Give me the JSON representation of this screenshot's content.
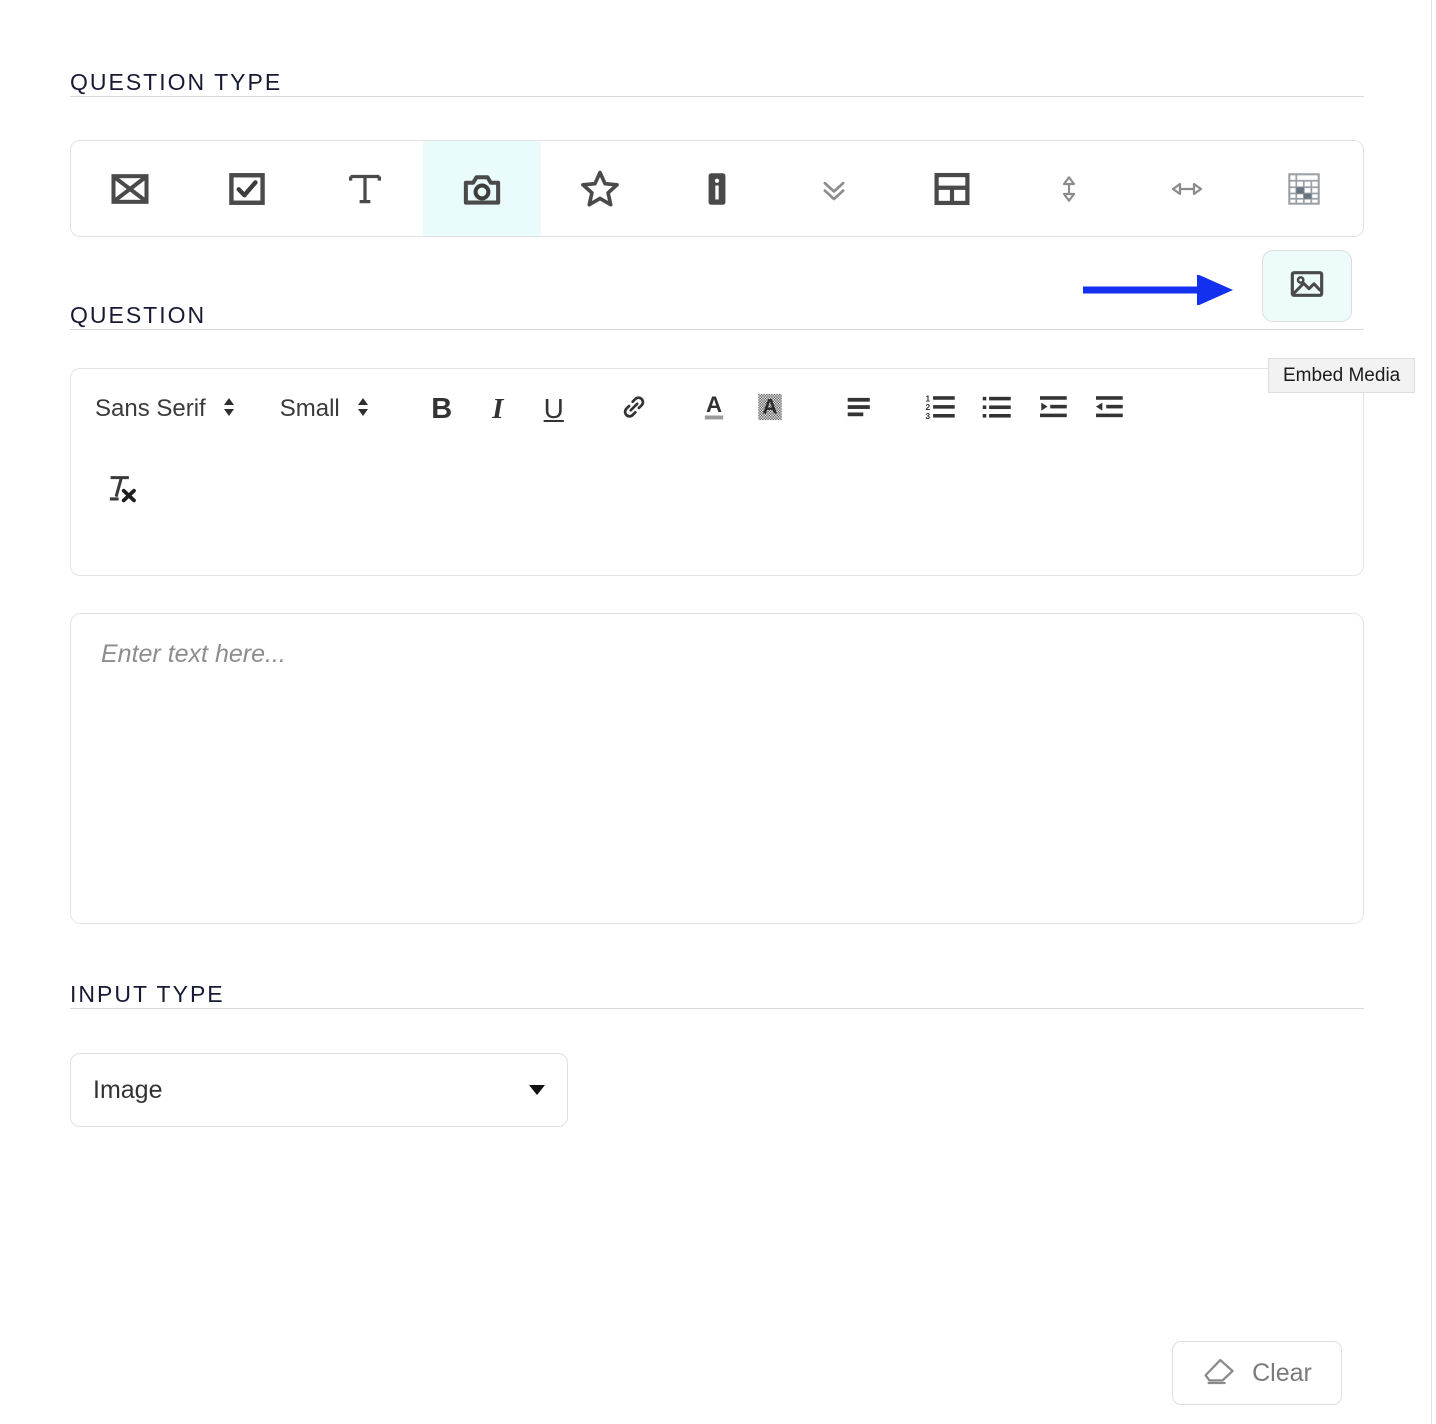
{
  "sections": {
    "question_type": {
      "title": "QUESTION TYPE"
    },
    "question": {
      "title": "QUESTION"
    },
    "input_type": {
      "title": "INPUT TYPE"
    }
  },
  "question_type_toolbar": {
    "items": [
      {
        "icon": "image-placeholder-icon",
        "name": "question-type-image-placeholder",
        "selected": false
      },
      {
        "icon": "checkbox-icon",
        "name": "question-type-checkbox",
        "selected": false
      },
      {
        "icon": "text-icon",
        "name": "question-type-text",
        "selected": false
      },
      {
        "icon": "camera-icon",
        "name": "question-type-camera",
        "selected": true
      },
      {
        "icon": "star-icon",
        "name": "question-type-rating",
        "selected": false
      },
      {
        "icon": "info-icon",
        "name": "question-type-info",
        "selected": false
      },
      {
        "icon": "double-chevron-down-icon",
        "name": "question-type-collapse",
        "selected": false
      },
      {
        "icon": "layout-icon",
        "name": "question-type-section",
        "selected": false
      },
      {
        "icon": "vertical-arrows-icon",
        "name": "question-type-vertical-spacer",
        "selected": false
      },
      {
        "icon": "horizontal-arrows-icon",
        "name": "question-type-horizontal-rule",
        "selected": false
      },
      {
        "icon": "table-icon",
        "name": "question-type-table",
        "selected": false
      }
    ]
  },
  "embed_media": {
    "button_icon": "image-icon",
    "tooltip": "Embed Media",
    "background_color": "#eefbfb",
    "annotation_arrow_color": "#1330f0"
  },
  "editor": {
    "font_family_value": "Sans Serif",
    "font_size_value": "Small",
    "tools": [
      {
        "label": "B",
        "name": "bold-button"
      },
      {
        "label": "I",
        "name": "italic-button"
      },
      {
        "label": "U",
        "name": "underline-button"
      },
      {
        "label": "link-icon",
        "name": "link-button"
      },
      {
        "label": "text-color-icon",
        "name": "text-color-button"
      },
      {
        "label": "background-color-icon",
        "name": "background-color-button"
      },
      {
        "label": "align-left-icon",
        "name": "align-button"
      },
      {
        "label": "ordered-list-icon",
        "name": "ordered-list-button"
      },
      {
        "label": "unordered-list-icon",
        "name": "unordered-list-button"
      },
      {
        "label": "outdent-icon",
        "name": "outdent-button"
      },
      {
        "label": "indent-icon",
        "name": "indent-button"
      },
      {
        "label": "clear-formatting-icon",
        "name": "clear-formatting-button"
      }
    ]
  },
  "answer": {
    "placeholder": "Enter text here..."
  },
  "input_type": {
    "selected_value": "Image"
  },
  "clear": {
    "label": "Clear",
    "icon": "eraser-icon"
  },
  "colors": {
    "heading": "#161a34",
    "selected_cell": "#e9fbfb",
    "arrow_blue": "#1330f0",
    "border": "#e2e2e2"
  }
}
